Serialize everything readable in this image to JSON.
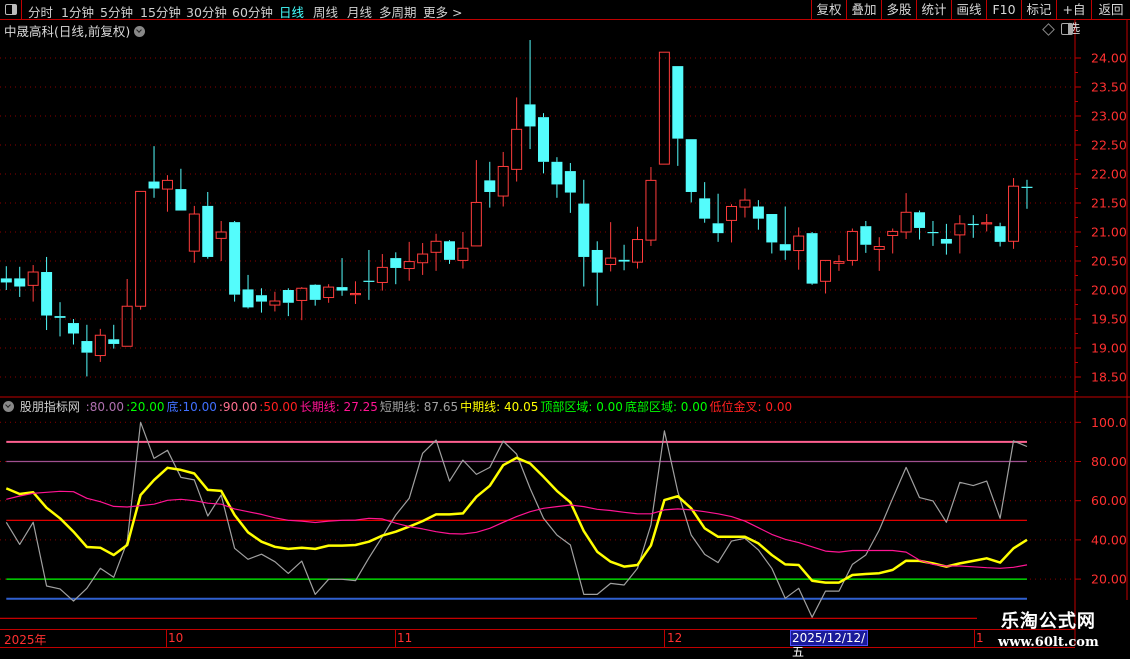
{
  "toolbar": {
    "periods": [
      "分时",
      "1分钟",
      "5分钟",
      "15分钟",
      "30分钟",
      "60分钟",
      "日线",
      "周线",
      "月线",
      "多周期",
      "更多 >"
    ],
    "active_period": "日线",
    "right_buttons": [
      "复权",
      "叠加",
      "多股",
      "统计",
      "画线",
      "F10",
      "标记",
      "+自选",
      "返回"
    ]
  },
  "chart_title": "中晟高科(日线,前复权)",
  "colors": {
    "up": "#ff3c3c",
    "down": "#54fcfc",
    "axis": "#ff3030",
    "border": "#c00000"
  },
  "price_axis": {
    "ticks": [
      "24.00",
      "23.50",
      "23.00",
      "22.50",
      "22.00",
      "21.50",
      "21.00",
      "20.50",
      "20.00",
      "19.50",
      "19.00",
      "18.50"
    ],
    "range": [
      18.25,
      24.6
    ]
  },
  "indicator": {
    "name": "股朋指标网",
    "legend": [
      {
        "text": ":80.00",
        "color": "#b070b0"
      },
      {
        "text": ":20.00",
        "color": "#00ff00"
      },
      {
        "text": "底:10.00",
        "color": "#4070ff"
      },
      {
        "text": ":90.00",
        "color": "#ff7090"
      },
      {
        "text": ":50.00",
        "color": "#ff2020"
      },
      {
        "text": "长期线: 27.25",
        "color": "#ff1493"
      },
      {
        "text": "短期线: 87.65",
        "color": "#a0a0a0"
      },
      {
        "text": "中期线: 40.05",
        "color": "#ffff00"
      },
      {
        "text": "顶部区域: 0.00",
        "color": "#00ff00"
      },
      {
        "text": "底部区域: 0.00",
        "color": "#00ff00"
      },
      {
        "text": "低位金叉: 0.00",
        "color": "#ff2020"
      }
    ],
    "axis_ticks": [
      "100.0",
      "80.00",
      "60.00",
      "40.00",
      "20.00"
    ],
    "levels": [
      {
        "value": 90,
        "color": "#ff6090"
      },
      {
        "value": 80,
        "color": "#a05090"
      },
      {
        "value": 50,
        "color": "#ff0000"
      },
      {
        "value": 20,
        "color": "#00ff00"
      },
      {
        "value": 10,
        "color": "#3060d0"
      },
      {
        "value": 0,
        "color": "#e00000"
      }
    ]
  },
  "time_axis": {
    "labels": [
      "2025年",
      "10",
      "11",
      "12",
      "1"
    ],
    "cursor_date": "2025/12/12/五"
  },
  "watermark": {
    "title": "乐淘公式网",
    "url": "www.60lt.com"
  },
  "chart_data": {
    "type": "candlestick",
    "ylim": [
      18.25,
      24.6
    ],
    "ohlc": [
      [
        20.2,
        20.41,
        20.0,
        20.13
      ],
      [
        20.2,
        20.4,
        19.88,
        20.06
      ],
      [
        20.08,
        20.43,
        19.8,
        20.31
      ],
      [
        20.31,
        20.57,
        19.31,
        19.56
      ],
      [
        19.55,
        19.79,
        19.2,
        19.52
      ],
      [
        19.43,
        19.5,
        19.06,
        19.25
      ],
      [
        19.12,
        19.4,
        18.51,
        18.92
      ],
      [
        18.87,
        19.33,
        18.76,
        19.22
      ],
      [
        19.15,
        19.4,
        18.99,
        19.07
      ],
      [
        19.03,
        20.19,
        19.03,
        19.72
      ],
      [
        19.72,
        21.7,
        19.66,
        21.7
      ],
      [
        21.87,
        22.48,
        21.59,
        21.75
      ],
      [
        21.74,
        21.98,
        21.35,
        21.89
      ],
      [
        21.74,
        22.09,
        21.37,
        21.37
      ],
      [
        20.67,
        21.45,
        20.47,
        21.31
      ],
      [
        21.45,
        21.69,
        20.54,
        20.57
      ],
      [
        20.89,
        21.19,
        20.5,
        21.0
      ],
      [
        21.17,
        21.19,
        19.8,
        19.92
      ],
      [
        20.01,
        20.26,
        19.68,
        19.7
      ],
      [
        19.91,
        20.03,
        19.61,
        19.8
      ],
      [
        19.74,
        19.97,
        19.63,
        19.81
      ],
      [
        20.0,
        20.03,
        19.55,
        19.78
      ],
      [
        19.82,
        20.05,
        19.48,
        20.03
      ],
      [
        20.09,
        20.1,
        19.73,
        19.83
      ],
      [
        19.87,
        20.1,
        19.78,
        20.05
      ],
      [
        20.05,
        20.55,
        19.9,
        19.99
      ],
      [
        19.92,
        20.15,
        19.76,
        19.94
      ],
      [
        20.16,
        20.69,
        19.83,
        20.15
      ],
      [
        20.13,
        20.62,
        19.99,
        20.39
      ],
      [
        20.55,
        20.65,
        20.1,
        20.38
      ],
      [
        20.37,
        20.83,
        20.16,
        20.49
      ],
      [
        20.47,
        20.81,
        20.26,
        20.62
      ],
      [
        20.65,
        20.97,
        20.33,
        20.84
      ],
      [
        20.84,
        20.86,
        20.45,
        20.52
      ],
      [
        20.51,
        21.0,
        20.37,
        20.72
      ],
      [
        20.76,
        22.24,
        20.76,
        21.51
      ],
      [
        21.89,
        22.21,
        21.42,
        21.69
      ],
      [
        21.62,
        22.38,
        21.44,
        22.13
      ],
      [
        22.08,
        23.32,
        21.87,
        22.77
      ],
      [
        23.2,
        24.31,
        22.43,
        22.82
      ],
      [
        22.98,
        23.05,
        22.01,
        22.21
      ],
      [
        22.21,
        22.29,
        21.59,
        21.82
      ],
      [
        22.05,
        22.19,
        21.33,
        21.68
      ],
      [
        21.49,
        21.9,
        20.06,
        20.57
      ],
      [
        20.69,
        20.84,
        19.73,
        20.3
      ],
      [
        20.44,
        21.17,
        20.32,
        20.55
      ],
      [
        20.52,
        20.78,
        20.34,
        20.49
      ],
      [
        20.48,
        21.09,
        20.37,
        20.87
      ],
      [
        20.86,
        22.12,
        20.76,
        21.89
      ],
      [
        22.17,
        24.1,
        22.17,
        24.1
      ],
      [
        23.86,
        23.86,
        22.14,
        22.61
      ],
      [
        22.6,
        22.6,
        21.51,
        21.69
      ],
      [
        21.58,
        21.86,
        21.16,
        21.23
      ],
      [
        21.15,
        21.66,
        20.83,
        20.98
      ],
      [
        21.2,
        21.48,
        20.82,
        21.44
      ],
      [
        21.43,
        21.75,
        21.25,
        21.55
      ],
      [
        21.44,
        21.55,
        21.04,
        21.23
      ],
      [
        21.31,
        21.31,
        20.63,
        20.82
      ],
      [
        20.79,
        21.44,
        20.52,
        20.68
      ],
      [
        20.68,
        21.08,
        20.35,
        20.93
      ],
      [
        20.98,
        21.0,
        20.09,
        20.11
      ],
      [
        20.15,
        20.51,
        19.94,
        20.51
      ],
      [
        20.46,
        20.6,
        20.33,
        20.49
      ],
      [
        20.51,
        21.06,
        20.42,
        21.01
      ],
      [
        21.1,
        21.19,
        20.64,
        20.78
      ],
      [
        20.7,
        20.91,
        20.33,
        20.75
      ],
      [
        20.94,
        21.06,
        20.63,
        21.01
      ],
      [
        21.0,
        21.67,
        20.88,
        21.34
      ],
      [
        21.34,
        21.37,
        20.87,
        21.07
      ],
      [
        21.0,
        21.19,
        20.76,
        20.98
      ],
      [
        20.88,
        21.14,
        20.61,
        20.8
      ],
      [
        20.95,
        21.29,
        20.63,
        21.14
      ],
      [
        21.14,
        21.29,
        20.9,
        21.13
      ],
      [
        21.14,
        21.31,
        21.01,
        21.16
      ],
      [
        21.1,
        21.16,
        20.75,
        20.83
      ],
      [
        20.84,
        21.93,
        20.71,
        21.79
      ],
      [
        21.78,
        21.9,
        21.4,
        21.76
      ]
    ],
    "indicator_ylim": [
      0,
      100
    ],
    "series": [
      {
        "name": "短期线",
        "color": "#a0a0a0",
        "values": [
          49.0,
          37.7,
          49.0,
          16.5,
          15.0,
          8.8,
          15.3,
          25.5,
          20.9,
          39.1,
          100,
          81.6,
          85.7,
          71.9,
          70.6,
          52.2,
          62.9,
          35.7,
          30.1,
          32.7,
          28.9,
          22.9,
          29.2,
          12.2,
          19.9,
          19.9,
          19.2,
          30.8,
          41.6,
          52.7,
          61.2,
          84.2,
          90.9,
          70.0,
          80.7,
          73.4,
          77.0,
          90.4,
          83.8,
          66.3,
          51.0,
          42.5,
          37.4,
          12.2,
          12.2,
          17.8,
          17.0,
          25.5,
          47.6,
          95.6,
          64.6,
          42.5,
          32.6,
          28.4,
          39.4,
          40.8,
          34.9,
          25.5,
          10.2,
          15.3,
          0.5,
          13.9,
          13.9,
          27.5,
          32.3,
          45.0,
          61.2,
          77.0,
          61.6,
          59.9,
          49.0,
          69.4,
          67.7,
          70.0,
          51.0,
          90.5,
          87.65
        ]
      },
      {
        "name": "中期线",
        "color": "#ffff00",
        "values": [
          66.3,
          63.4,
          64.3,
          56.4,
          51.0,
          44.2,
          36.4,
          36.0,
          32.3,
          37.4,
          62.9,
          70.5,
          76.8,
          75.7,
          73.9,
          65.5,
          65.0,
          52.7,
          43.9,
          39.1,
          36.5,
          35.4,
          36.0,
          35.4,
          37.1,
          37.1,
          37.4,
          39.1,
          42.2,
          44.2,
          46.8,
          49.6,
          53.0,
          53.0,
          53.5,
          62.0,
          67.6,
          78.1,
          81.9,
          79.0,
          72.2,
          65.0,
          59.2,
          44.5,
          34.0,
          28.9,
          26.4,
          27.2,
          37.1,
          60.3,
          62.3,
          56.1,
          45.9,
          41.6,
          41.6,
          41.6,
          38.2,
          32.3,
          27.5,
          27.2,
          19.2,
          18.2,
          18.2,
          22.1,
          22.6,
          23.0,
          24.7,
          29.4,
          29.3,
          28.0,
          26.4,
          28.0,
          29.3,
          30.6,
          28.4,
          35.7,
          40.05
        ]
      },
      {
        "name": "长期线",
        "color": "#ff1493",
        "values": [
          60.7,
          62.4,
          63.8,
          64.3,
          64.8,
          64.6,
          61.2,
          59.5,
          57.1,
          56.8,
          57.5,
          58.2,
          60.2,
          60.7,
          60.0,
          58.7,
          58.2,
          55.8,
          54.4,
          53.0,
          51.3,
          50.0,
          49.6,
          48.9,
          49.6,
          50.0,
          50.1,
          51.0,
          50.7,
          48.5,
          46.8,
          45.6,
          44.2,
          43.2,
          43.0,
          43.9,
          45.9,
          49.0,
          51.9,
          54.4,
          56.1,
          57.0,
          57.8,
          57.0,
          55.6,
          55.0,
          54.1,
          53.3,
          53.3,
          55.3,
          55.8,
          55.3,
          54.4,
          53.3,
          51.9,
          49.6,
          46.2,
          42.8,
          40.3,
          38.6,
          36.5,
          34.3,
          33.8,
          34.6,
          34.6,
          34.6,
          34.6,
          33.8,
          29.7,
          27.5,
          26.7,
          26.7,
          26.3,
          25.8,
          25.5,
          26.0,
          27.25
        ]
      }
    ]
  }
}
